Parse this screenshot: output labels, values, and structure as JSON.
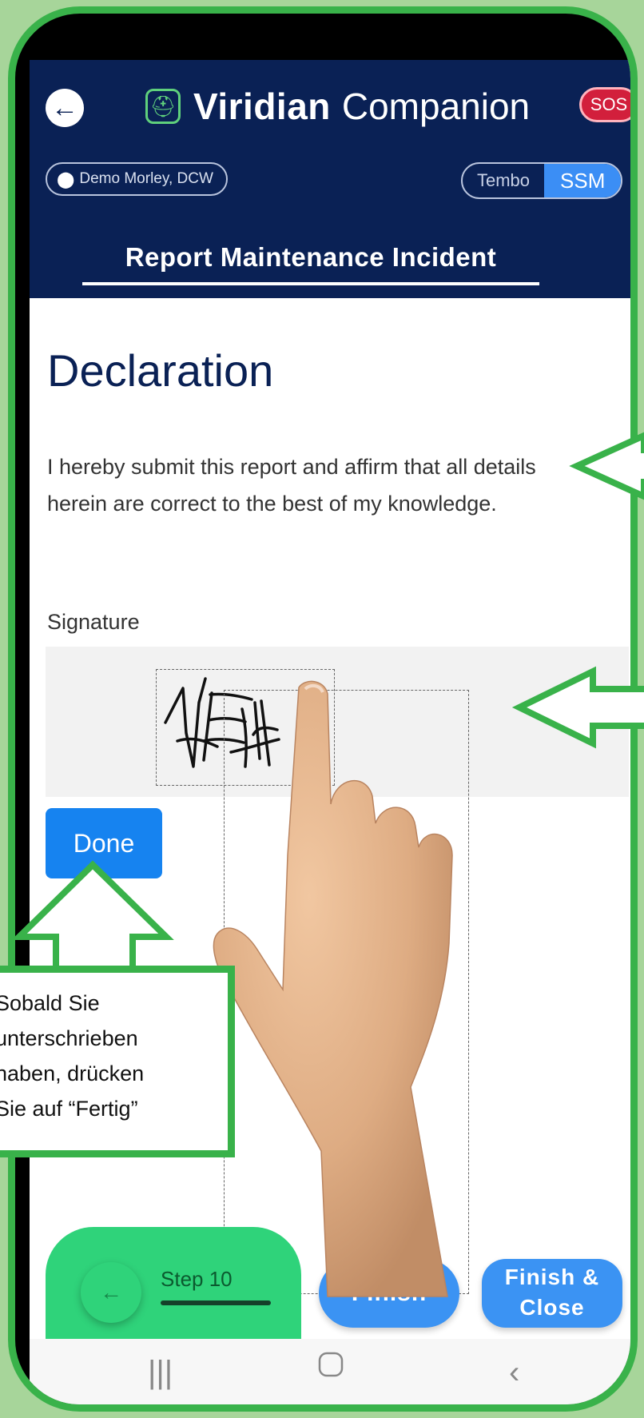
{
  "header": {
    "brand": "Viridian",
    "app_name": "Companion",
    "sos_label": "SOS",
    "location": "Demo Morley, DCW",
    "toggle_options": [
      "Tembo",
      "SSM"
    ],
    "toggle_selected": "SSM",
    "report_title": "Report Maintenance Incident"
  },
  "main": {
    "heading": "Declaration",
    "declaration_text": "I hereby submit this report and affirm that all details herein are correct to the best of my knowledge.",
    "signature_label": "Signature",
    "signature_text": "1FEI",
    "done_label": "Done"
  },
  "footer": {
    "step_label": "Step 10",
    "finish_label": "Finish",
    "finish_close_label": "Finish & Close"
  },
  "callout": {
    "lines": [
      "Sobald Sie",
      "unterschrieben",
      "haben, drücken",
      "Sie auf “Fertig”"
    ]
  },
  "colors": {
    "background": "#a7d59a",
    "frame": "#39b24a",
    "header": "#0a2155",
    "primary_button": "#1683f0",
    "step_panel": "#2fd37a",
    "sos": "#d21f3c"
  },
  "icons": {
    "back": "arrow-left-icon",
    "app": "helmet-icon",
    "location": "location-pin-icon",
    "step_back": "arrow-left-icon",
    "nav_recents": "recents-icon",
    "nav_home": "home-icon",
    "nav_back": "chevron-left-icon"
  }
}
